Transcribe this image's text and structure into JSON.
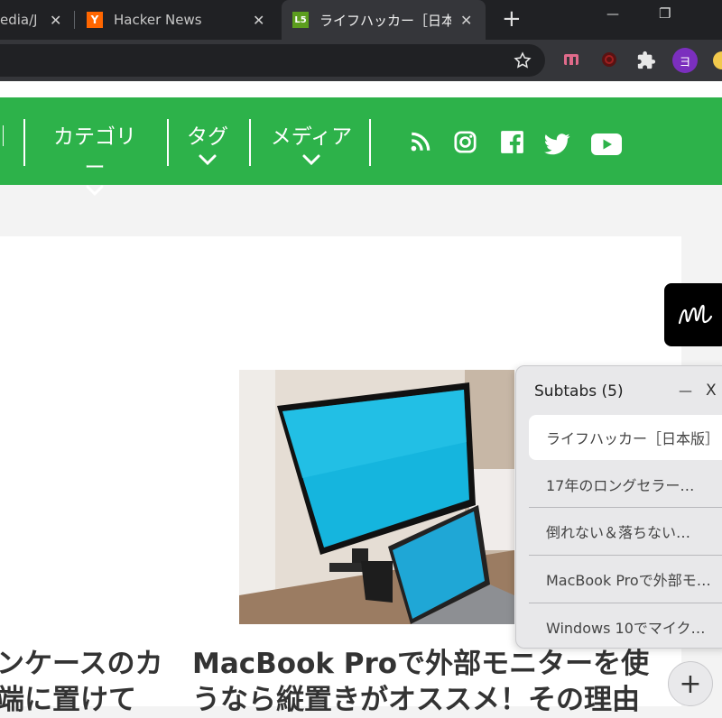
{
  "browser": {
    "tabs": [
      {
        "label": "edia/Ja",
        "favicon": "",
        "close": "✕"
      },
      {
        "label": "Hacker News",
        "favicon": "Y",
        "close": "✕"
      },
      {
        "label": "ライフハッカー［日本版］",
        "favicon": "L5",
        "close": "✕"
      }
    ],
    "new_tab": "+",
    "window": {
      "minimize": "—",
      "restore": "❐",
      "close": "✕"
    },
    "extension_avatar": "ヨ"
  },
  "site_nav": {
    "items": [
      {
        "label": "カテゴリー"
      },
      {
        "label": "タグ"
      },
      {
        "label": "メディア"
      }
    ],
    "social_icons": [
      "rss-icon",
      "instagram-icon",
      "facebook-icon",
      "twitter-icon",
      "youtube-icon"
    ],
    "accent": "#2db24a"
  },
  "articles": {
    "left_headline": [
      "ンケースのカ",
      "端に置けて"
    ],
    "main_headline": [
      "MacBook Proで外部モニターを使",
      "うなら縦置きがオススメ！その理由"
    ]
  },
  "subtabs": {
    "title": "Subtabs (5)",
    "minimize": "—",
    "close": "X",
    "items": [
      {
        "label": "ライフハッカー［日本版］"
      },
      {
        "label": "17年のロングセラー…"
      },
      {
        "label": "倒れない＆落ちない…"
      },
      {
        "label": "MacBook Proで外部モ…"
      },
      {
        "label": "Windows 10でマイク…"
      }
    ],
    "add": "+"
  },
  "ml_badge": "ml-logo-icon"
}
